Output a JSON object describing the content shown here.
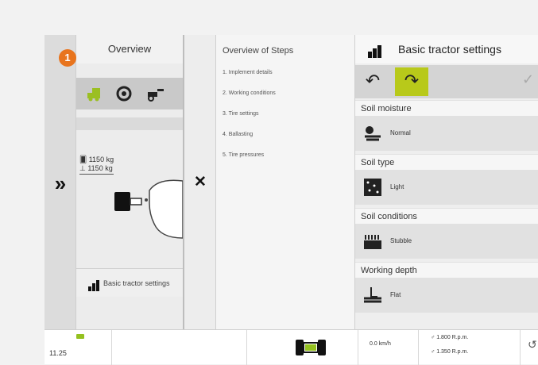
{
  "badge": "1",
  "overview": {
    "tab_label": "Overview",
    "weights": [
      "1150 kg",
      "1150 kg"
    ],
    "basic_tractor_label": "Basic tractor settings"
  },
  "steps": {
    "title": "Overview of Steps",
    "items": [
      "1. Implement details",
      "2. Working conditions",
      "3. Tire settings",
      "4. Ballasting",
      "5. Tire pressures"
    ]
  },
  "settings": {
    "title": "Basic tractor settings",
    "sections": [
      {
        "label": "Soil moisture",
        "value": "Normal",
        "icon": "soil-moisture-icon"
      },
      {
        "label": "Soil type",
        "value": "Light",
        "icon": "soil-type-icon"
      },
      {
        "label": "Soil conditions",
        "value": "Stubble",
        "icon": "stubble-icon"
      },
      {
        "label": "Working depth",
        "value": "Flat",
        "icon": "working-depth-icon"
      }
    ]
  },
  "status_bar": {
    "time": "11.25",
    "speed": "0.0 km/h",
    "rpm_1": "1.800 R.p.m.",
    "rpm_2": "1.350 R.p.m."
  },
  "colors": {
    "accent_green": "#b8c91a",
    "badge_orange": "#e8741d"
  }
}
